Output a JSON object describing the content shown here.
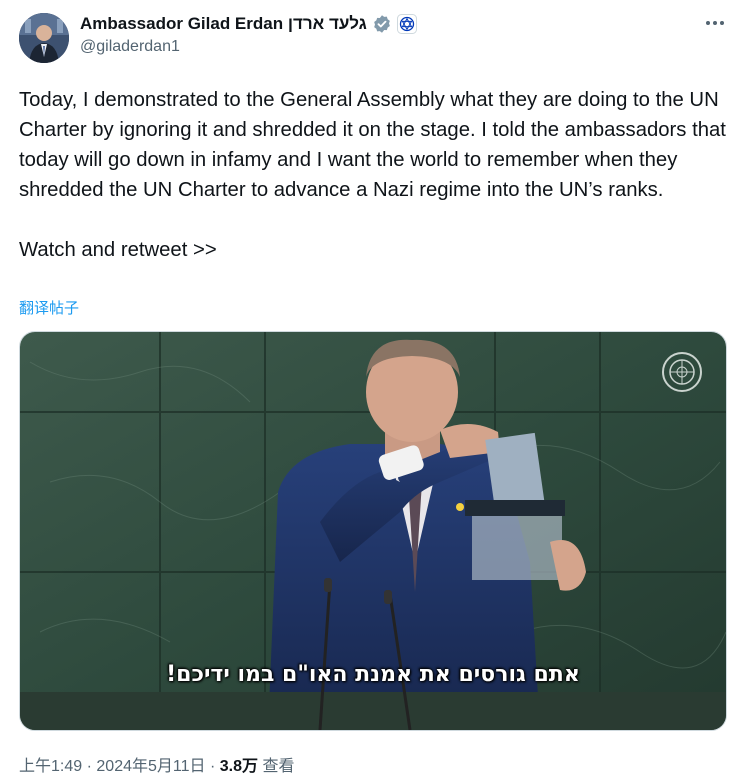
{
  "author": {
    "display_name": "Ambassador Gilad Erdan גלעד ארדן",
    "handle": "@giladerdan1"
  },
  "tweet": {
    "paragraph1": "Today, I demonstrated to the General Assembly what they are doing to the UN Charter by ignoring it and shredded it on the stage. I told the ambassadors that today will go down in infamy and I want the world to remember when they shredded the UN Charter to advance a Nazi regime into the UN’s ranks.",
    "paragraph2": "Watch and retweet >>",
    "translate_label": "翻译帖子"
  },
  "media": {
    "subtitle": "אתם גורסים את אמנת האו\"ם במו ידיכם!"
  },
  "meta": {
    "time": "上午1:49",
    "separator": "·",
    "date": "2024年5月11日",
    "views_count": "3.8万",
    "views_label": "查看"
  },
  "icons": {
    "verified": "verified-badge-icon",
    "affiliation": "un-affiliation-badge-icon",
    "more": "more-options-icon"
  },
  "colors": {
    "link": "#1d9bf0",
    "secondary_text": "#536471",
    "verified_badge": "#829aab"
  }
}
